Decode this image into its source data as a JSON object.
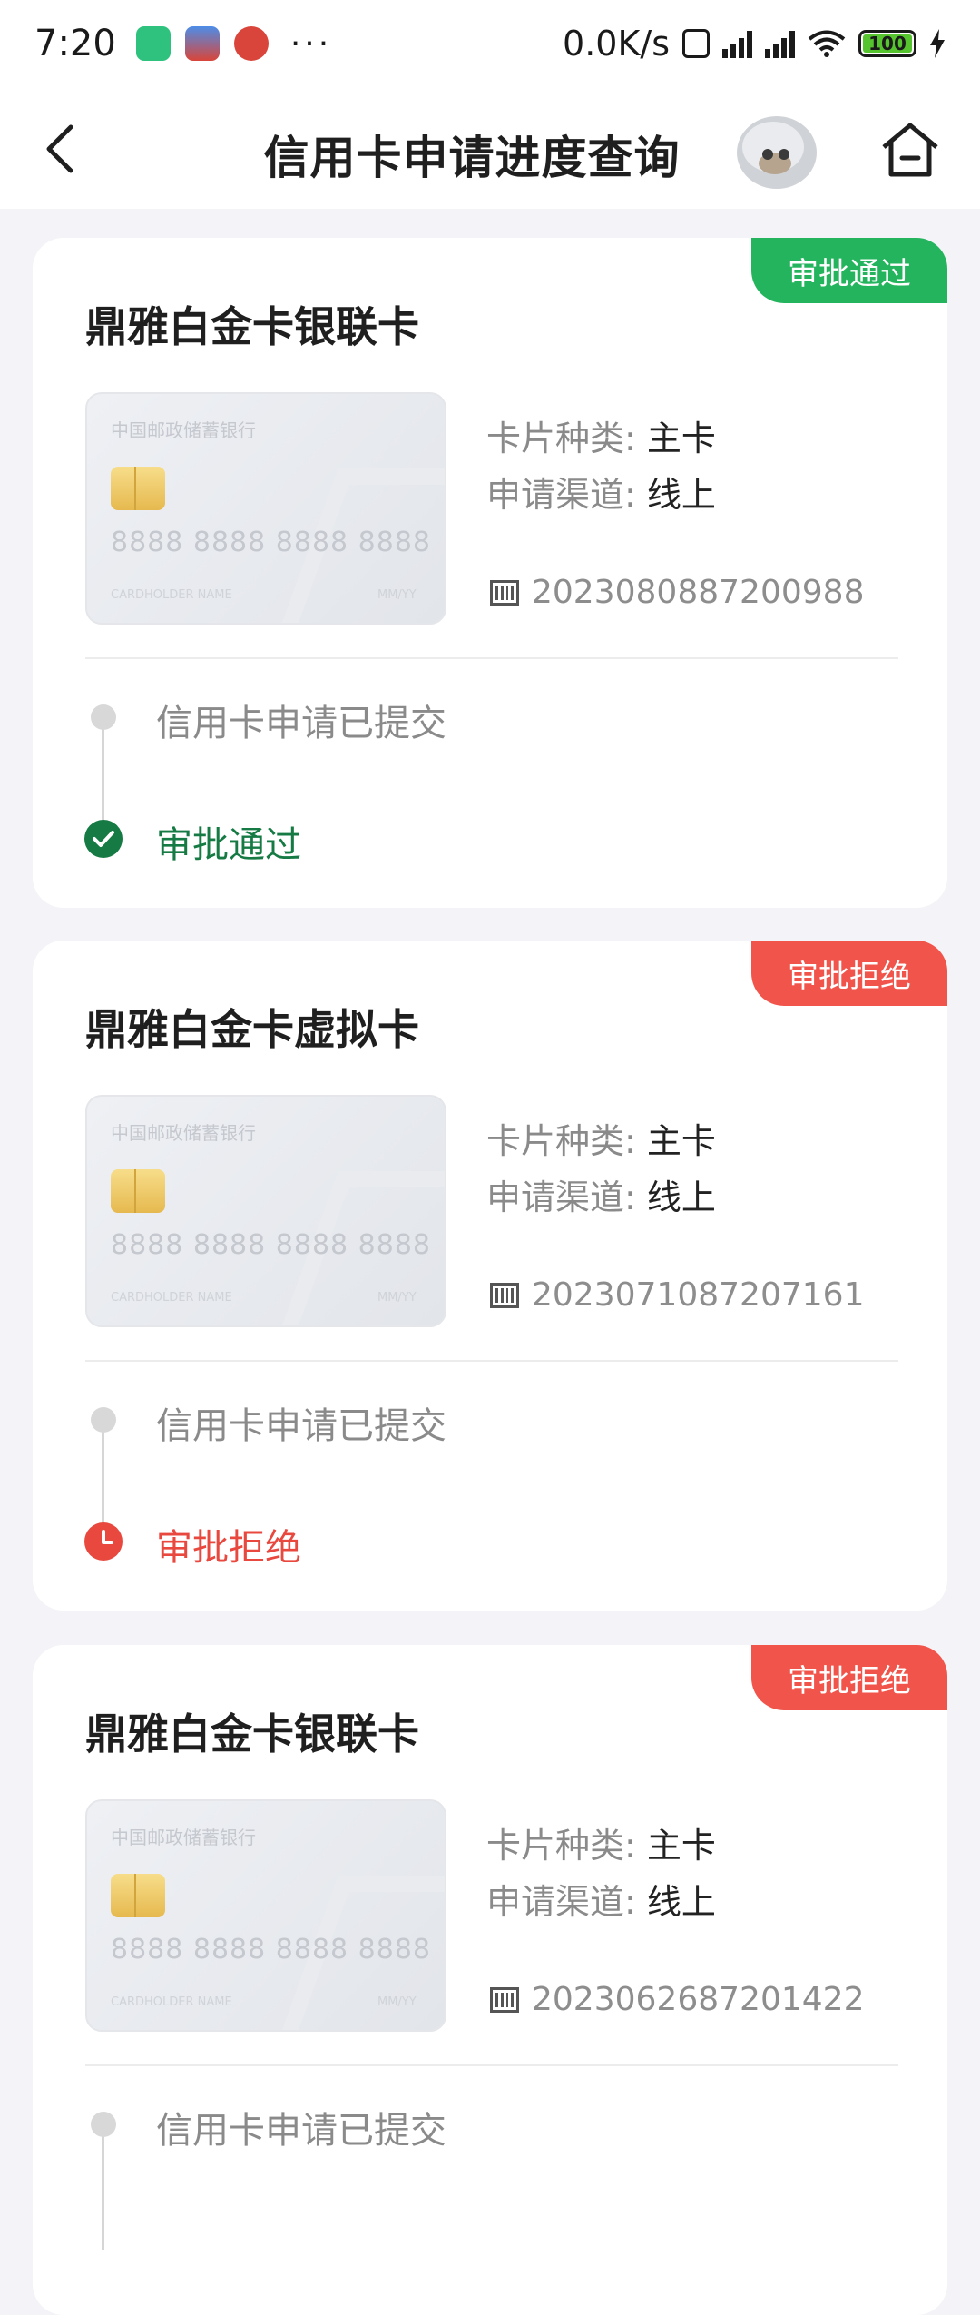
{
  "status_bar": {
    "time": "7:20",
    "dots": "···",
    "speed": "0.0K/s",
    "battery": "100"
  },
  "header": {
    "title": "信用卡申请进度查询",
    "back_icon": "chevron-left-icon",
    "home_icon": "home-icon"
  },
  "cards": [
    {
      "title": "鼎雅白金卡银联卡",
      "status": "审批通过",
      "status_color": "#25b45e",
      "card_image": {
        "bank": "中国邮政储蓄银行",
        "number": "8888 8888 8888 8888",
        "holder": "CARDHOLDER NAME",
        "expiry": "MM/YY"
      },
      "type_label": "卡片种类:",
      "type_value": "主卡",
      "channel_label": "申请渠道:",
      "channel_value": "线上",
      "application_no": "2023080887200988",
      "steps": [
        {
          "text": "信用卡申请已提交"
        },
        {
          "text": "审批通过",
          "icon": "check-circle-icon"
        }
      ]
    },
    {
      "title": "鼎雅白金卡虚拟卡",
      "status": "审批拒绝",
      "status_color": "#f1544a",
      "card_image": {
        "bank": "中国邮政储蓄银行",
        "number": "8888 8888 8888 8888",
        "holder": "CARDHOLDER NAME",
        "expiry": "MM/YY"
      },
      "type_label": "卡片种类:",
      "type_value": "主卡",
      "channel_label": "申请渠道:",
      "channel_value": "线上",
      "application_no": "2023071087207161",
      "steps": [
        {
          "text": "信用卡申请已提交"
        },
        {
          "text": "审批拒绝",
          "icon": "clock-circle-icon"
        }
      ]
    },
    {
      "title": "鼎雅白金卡银联卡",
      "status": "审批拒绝",
      "status_color": "#f1544a",
      "card_image": {
        "bank": "中国邮政储蓄银行",
        "number": "8888 8888 8888 8888",
        "holder": "CARDHOLDER NAME",
        "expiry": "MM/YY"
      },
      "type_label": "卡片种类:",
      "type_value": "主卡",
      "channel_label": "申请渠道:",
      "channel_value": "线上",
      "application_no": "2023062687201422",
      "steps": [
        {
          "text": "信用卡申请已提交"
        }
      ]
    }
  ]
}
